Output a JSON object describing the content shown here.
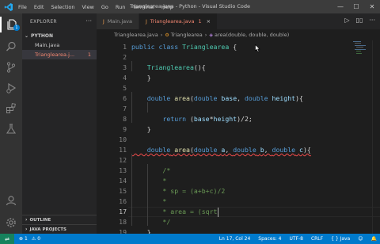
{
  "window": {
    "title": "Trianglearea.java - Python - Visual Studio Code",
    "menu": [
      "File",
      "Edit",
      "Selection",
      "View",
      "Go",
      "Run",
      "Terminal",
      "Help"
    ],
    "controls": {
      "minimize": "—",
      "maximize": "☐",
      "close": "✕"
    }
  },
  "activity": {
    "icons": [
      "explorer-icon",
      "search-icon",
      "source-control-icon",
      "run-debug-icon",
      "extensions-icon",
      "testing-icon",
      "account-icon",
      "settings-icon"
    ],
    "explorer_badge": "1"
  },
  "sidebar": {
    "title": "EXPLORER",
    "more": "···",
    "folder": "PYTHON",
    "files": [
      {
        "name": "Main.java",
        "error_count": ""
      },
      {
        "name": "Trianglearea.j...",
        "error_count": "1"
      }
    ],
    "sections": [
      "OUTLINE",
      "JAVA PROJECTS"
    ]
  },
  "tabs": [
    {
      "label": "Main.java",
      "icon": "java-file-icon",
      "active": false,
      "error_count": ""
    },
    {
      "label": "Trianglearea.java",
      "icon": "java-file-icon",
      "active": true,
      "error_count": "1"
    }
  ],
  "tab_actions": {
    "run": "▷",
    "split": "▯▯",
    "more": "···"
  },
  "tab_close": "×",
  "breadcrumb": {
    "file": "Trianglearea.java",
    "class": "Trianglearea",
    "method": "area(double, double, double)"
  },
  "editor": {
    "current_line": 17,
    "lines": [
      {
        "n": "1",
        "text": "public class Trianglearea {"
      },
      {
        "n": "2",
        "text": ""
      },
      {
        "n": "3",
        "text": "    Trianglearea(){"
      },
      {
        "n": "4",
        "text": "    }"
      },
      {
        "n": "5",
        "text": ""
      },
      {
        "n": "6",
        "text": "    double area(double base, double height){"
      },
      {
        "n": "7",
        "text": ""
      },
      {
        "n": "8",
        "text": "        return (base*height)/2;"
      },
      {
        "n": "9",
        "text": "    }"
      },
      {
        "n": "10",
        "text": ""
      },
      {
        "n": "11",
        "text": "    double area(double a, double b, double c){"
      },
      {
        "n": "12",
        "text": ""
      },
      {
        "n": "13",
        "text": "        /*"
      },
      {
        "n": "14",
        "text": "        *"
      },
      {
        "n": "15",
        "text": "        * sp = (a+b+c)/2"
      },
      {
        "n": "16",
        "text": "        *"
      },
      {
        "n": "17",
        "text": "        * area = (sqrt"
      },
      {
        "n": "18",
        "text": "        */"
      },
      {
        "n": "19",
        "text": "    }"
      }
    ]
  },
  "status": {
    "remote": "⇌",
    "errors": "1",
    "warnings": "0",
    "cursor": "Ln 17, Col 24",
    "spaces": "Spaces: 4",
    "encoding": "UTF-8",
    "eol": "CRLF",
    "language": "Java",
    "language_braces": "{ }",
    "feedback": "☺",
    "bell": "🔔"
  },
  "colors": {
    "accent": "#007acc",
    "error": "#f48771",
    "keyword": "#569cd6",
    "type": "#4ec9b0",
    "function": "#dcdcaa",
    "variable": "#9cdcfe",
    "comment": "#6a9955"
  }
}
